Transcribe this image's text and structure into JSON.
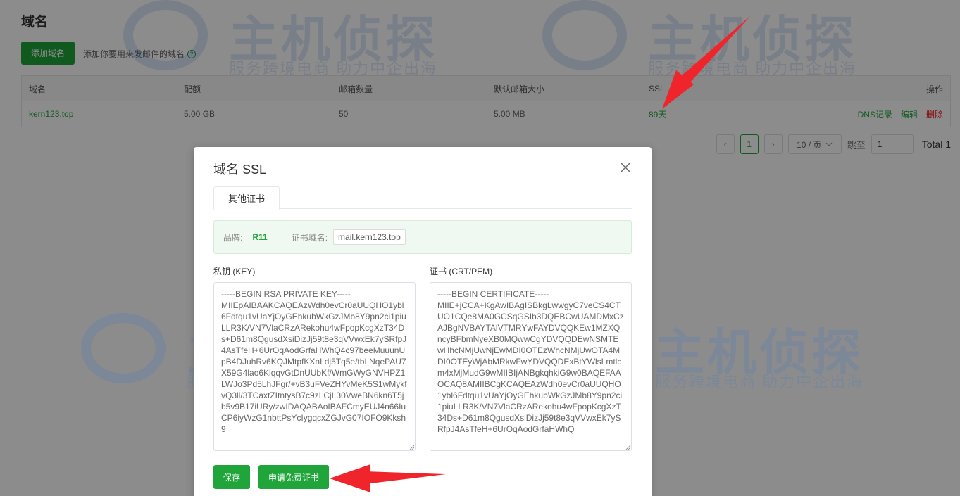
{
  "page": {
    "title": "域名",
    "add_button": "添加域名",
    "add_hint": "添加你要用来发邮件的域名",
    "help_glyph": "?"
  },
  "table": {
    "headers": [
      "域名",
      "配额",
      "邮箱数量",
      "默认邮箱大小",
      "SSL",
      "操作"
    ],
    "rows": [
      {
        "domain": "kern123.top",
        "quota": "5.00 GB",
        "mailbox_count": "50",
        "default_size": "5.00 MB",
        "ssl": "89天",
        "ops": [
          "DNS记录",
          "编辑",
          "删除"
        ]
      }
    ]
  },
  "pager": {
    "prev": "‹",
    "current": "1",
    "next": "›",
    "per_page": "10 / 页",
    "jump_label": "跳至",
    "jump_value": "1",
    "total": "Total 1"
  },
  "watermark": {
    "main": "主机侦探",
    "sub": "服务跨境电商 助力中企出海"
  },
  "modal": {
    "title": "域名 SSL",
    "tab": "其他证书",
    "brand_label": "品牌:",
    "brand_value": "R11",
    "cert_domain_label": "证书域名:",
    "cert_domain_value": "mail.kern123.top",
    "key_label": "私钥 (KEY)",
    "cert_label": "证书 (CRT/PEM)",
    "key_text": "-----BEGIN RSA PRIVATE KEY-----\nMIIEpAIBAAKCAQEAzWdh0evCr0aUUQHO1ybl6Fdtqu1vUaYjOyGEhkubWkGzJMb8Y9pn2ci1piuLLR3K/VN7VlaCRzARekohu4wFpopKcgXzT34Ds+D61m8QgusdXsiDizJj59t8e3qVVwxEk7ySRfpJ4AsTfeH+6UrOqAodGrfaHWhQ4c97beeMuuunUpB4DJuhRv6KQJMtpfKXnLdj5Tq5e/tbLNqePAU7X59G4lao6KlqqvGtDnUUbKf/WmGWyGNVHPZ1LWJo3Pd5LhJFgr/+vB3uFVeZHYvMeK5S1wMykfvQ3ll/3TCaxtZItntysB7c9zLCjL30VweBN6kn6T5jb5v9B17iURy/zwIDAQABAoIBAFCmyEUJ4n66IuCP6iyWzG1nbttPsYcIygqcxZGJvG07IOFO9Kksh9",
    "cert_text": "-----BEGIN CERTIFICATE-----\nMIIE+jCCA+KgAwIBAgISBkgLwwgyC7veCS4CTUO1CQe8MA0GCSqGSIb3DQEBCwUAMDMxCzAJBgNVBAYTAlVTMRYwFAYDVQQKEw1MZXQncyBFbmNyeXB0MQwwCgYDVQQDEwNSMTEwHhcNMjUwNjEwMDI0OTEzWhcNMjUwOTA4MDI0OTEyWjAbMRkwFwYDVQQDExBtYWlsLmtlcm4xMjMudG9wMIIBIjANBgkqhkiG9w0BAQEFAAOCAQ8AMIIBCgKCAQEAzWdh0evCr0aUUQHO1ybl6Fdtqu1vUaYjOyGEhkubWkGzJMb8Y9pn2ci1piuLLR3K/VN7VlaCRzARekohu4wFpopKcgXzT34Ds+D61m8QgusdXsiDizJj59t8e3qVVwxEk7ySRfpJ4AsTfeH+6UrOqAodGrfaHWhQ",
    "save_button": "保存",
    "free_cert_button": "申请免费证书"
  },
  "colors": {
    "accent": "#20a53a",
    "danger": "#ef0808",
    "arrow": "#f0252b"
  }
}
